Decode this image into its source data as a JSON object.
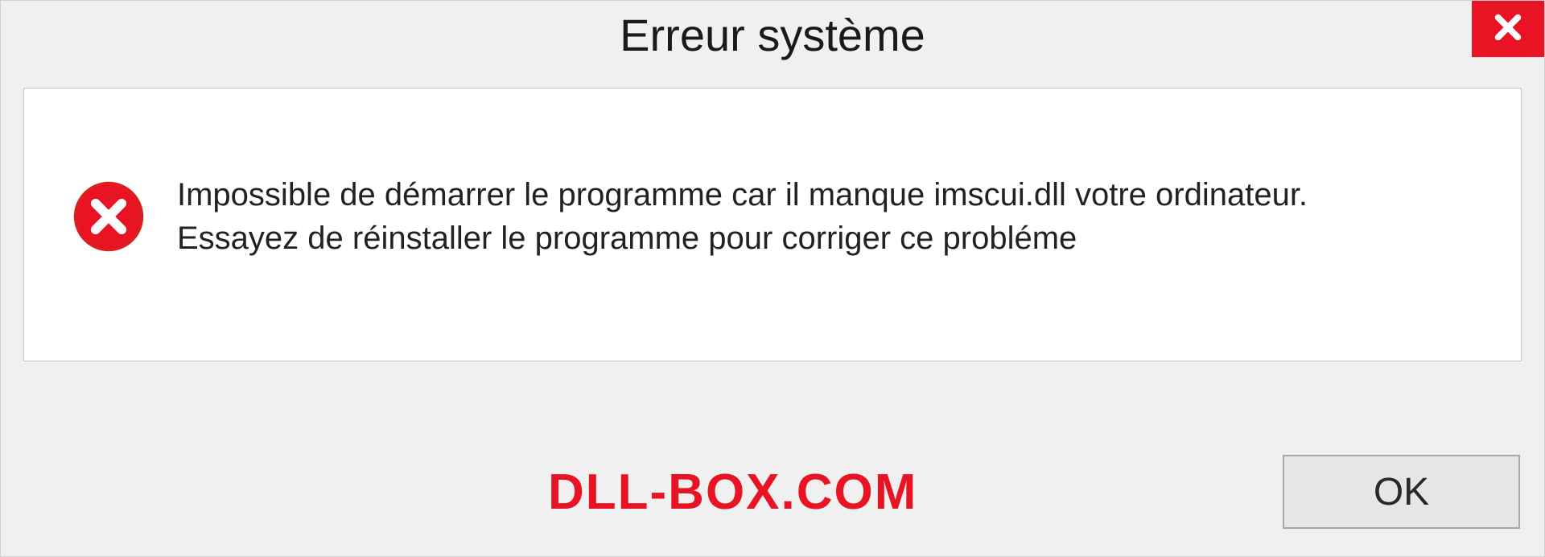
{
  "dialog": {
    "title": "Erreur système",
    "message": "Impossible de démarrer le programme car il manque imscui.dll votre ordinateur. Essayez de réinstaller le programme pour corriger ce probléme",
    "ok_label": "OK"
  },
  "watermark": "DLL-BOX.COM"
}
